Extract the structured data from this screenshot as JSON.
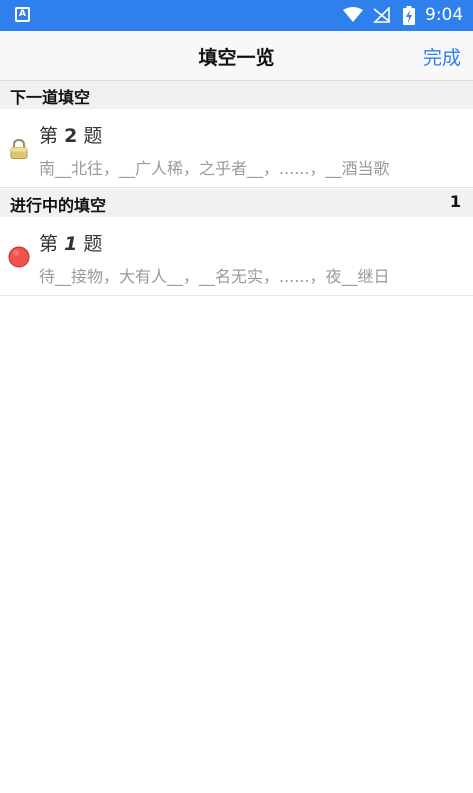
{
  "status_bar": {
    "time": "9:04",
    "app_icon_letter": "A",
    "icons": [
      "app-icon",
      "wifi-icon",
      "no-signal-icon",
      "battery-charging-icon"
    ]
  },
  "navbar": {
    "title": "填空一览",
    "done_label": "完成"
  },
  "sections": [
    {
      "header": "下一道填空",
      "count": "",
      "items": [
        {
          "prefix": "第",
          "number": "2",
          "suffix": "题",
          "preview": "南__北往，__广人稀，之乎者__，......，__酒当歌",
          "icon": "lock-icon"
        }
      ]
    },
    {
      "header": "进行中的填空",
      "count": "1",
      "items": [
        {
          "prefix": "第",
          "number": "1",
          "suffix": "题",
          "preview": "待__接物，大有人__，__名无实，......，夜__继日",
          "icon": "red-dot-icon"
        }
      ]
    }
  ],
  "colors": {
    "status_bar": "#2f80ed",
    "accent": "#2f7ff0",
    "section_bg": "#f1f1f1",
    "red_dot": "#ef5350"
  }
}
